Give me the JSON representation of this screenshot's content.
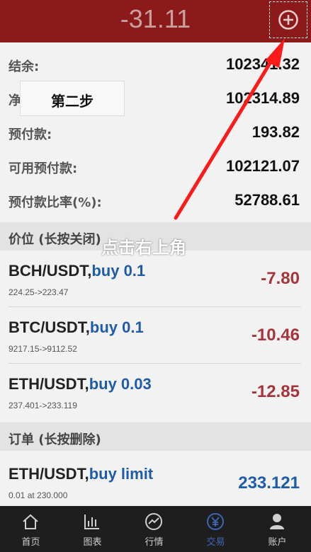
{
  "header": {
    "value": "-31.11",
    "add_icon": "plus-circle-icon"
  },
  "account": {
    "rows": [
      {
        "label": "结余:",
        "value": "102341.32"
      },
      {
        "label": "净值:",
        "value": "102314.89"
      },
      {
        "label": "预付款:",
        "value": "193.82"
      },
      {
        "label": "可用预付款:",
        "value": "102121.07"
      },
      {
        "label": "预付款比率(%):",
        "value": "52788.61"
      }
    ]
  },
  "annotation": {
    "step_label": "第二步",
    "instruction": "点击右上角",
    "arrow_color": "#ff1a1a"
  },
  "positions": {
    "title": "价位 (长按关闭)",
    "items": [
      {
        "symbol": "BCH/USDT,",
        "side": "buy 0.1",
        "detail": "224.25->223.47",
        "pnl": "-7.80"
      },
      {
        "symbol": "BTC/USDT,",
        "side": "buy 0.1",
        "detail": "9217.15->9112.52",
        "pnl": "-10.46"
      },
      {
        "symbol": "ETH/USDT,",
        "side": "buy 0.03",
        "detail": "237.401->233.119",
        "pnl": "-12.85"
      }
    ]
  },
  "orders": {
    "title": "订单 (长按删除)",
    "items": [
      {
        "symbol": "ETH/USDT,",
        "side": "buy limit",
        "detail": "0.01 at 230.000",
        "price": "233.121"
      }
    ]
  },
  "nav": {
    "items": [
      {
        "label": "首页",
        "icon": "home-icon"
      },
      {
        "label": "图表",
        "icon": "chart-icon"
      },
      {
        "label": "行情",
        "icon": "trend-icon"
      },
      {
        "label": "交易",
        "icon": "yen-icon",
        "active": true
      },
      {
        "label": "账户",
        "icon": "user-icon"
      }
    ]
  },
  "colors": {
    "header_bg": "#8c1a1a",
    "loss": "#a5353a",
    "side": "#1f5ca8",
    "nav_active": "#3e67b8"
  }
}
